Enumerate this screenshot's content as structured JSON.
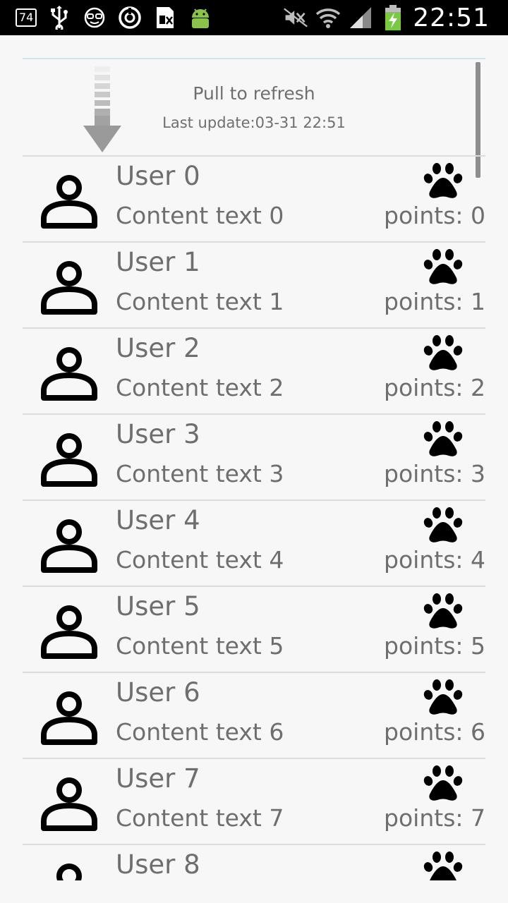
{
  "status_bar": {
    "battery_badge": "74",
    "clock": "22:51",
    "left_icons": [
      "notification-count-icon",
      "usb-icon",
      "glasses-face-icon",
      "sync-circle-icon",
      "sim-card-icon",
      "android-icon"
    ],
    "right_icons": [
      "mute-icon",
      "wifi-icon",
      "signal-icon",
      "battery-charging-icon"
    ]
  },
  "refresh_header": {
    "title": "Pull to refresh",
    "last_update": "Last update:03-31 22:51"
  },
  "list": {
    "items": [
      {
        "user": "User 0",
        "content": "Content text 0",
        "points": "points: 0"
      },
      {
        "user": "User 1",
        "content": "Content text 1",
        "points": "points: 1"
      },
      {
        "user": "User 2",
        "content": "Content text 2",
        "points": "points: 2"
      },
      {
        "user": "User 3",
        "content": "Content text 3",
        "points": "points: 3"
      },
      {
        "user": "User 4",
        "content": "Content text 4",
        "points": "points: 4"
      },
      {
        "user": "User 5",
        "content": "Content text 5",
        "points": "points: 5"
      },
      {
        "user": "User 6",
        "content": "Content text 6",
        "points": "points: 6"
      },
      {
        "user": "User 7",
        "content": "Content text 7",
        "points": "points: 7"
      },
      {
        "user": "User 8",
        "content": "",
        "points": ""
      }
    ]
  },
  "colors": {
    "background": "#f7f7f7",
    "text": "#6e6e6e",
    "divider": "#dcdcdc",
    "charging": "#7ac943",
    "android": "#8bc34a"
  }
}
